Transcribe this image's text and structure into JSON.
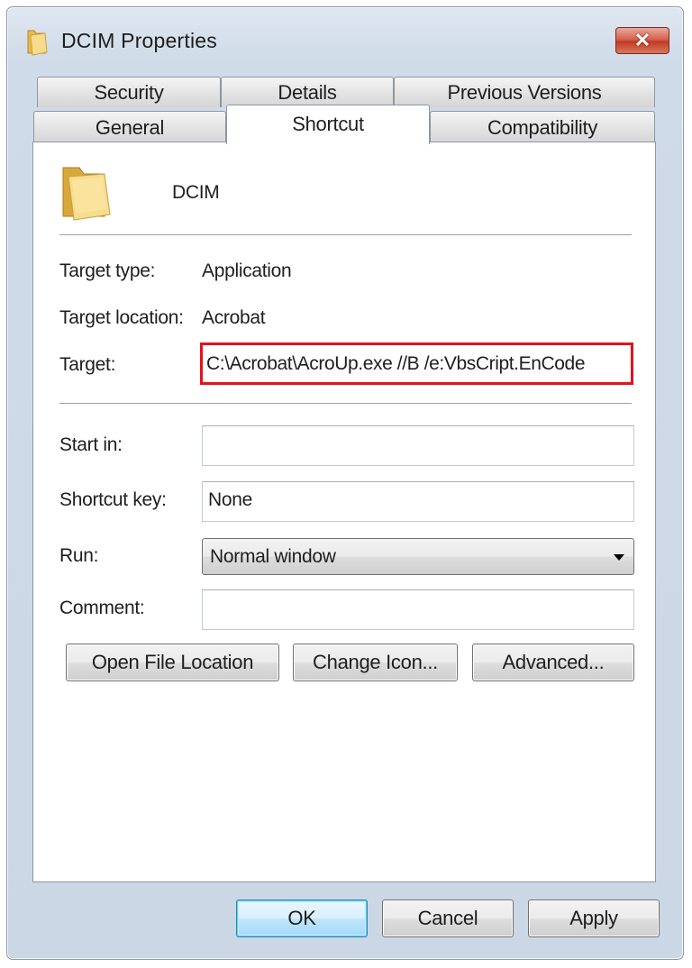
{
  "window": {
    "title": "DCIM Properties",
    "close_glyph": "✕"
  },
  "tabs_row1": [
    "Security",
    "Details",
    "Previous Versions"
  ],
  "tabs_row2": [
    "General",
    "Shortcut",
    "Compatibility"
  ],
  "active_tab": "Shortcut",
  "shortcut": {
    "name": "DCIM",
    "target_type_label": "Target type:",
    "target_type_value": "Application",
    "target_location_label": "Target location:",
    "target_location_value": "Acrobat",
    "target_label": "Target:",
    "target_value": "C:\\Acrobat\\AcroUp.exe //B /e:VbsCript.EnCode",
    "start_in_label": "Start in:",
    "start_in_value": "",
    "shortcut_key_label": "Shortcut key:",
    "shortcut_key_value": "None",
    "run_label": "Run:",
    "run_value": "Normal window",
    "comment_label": "Comment:",
    "comment_value": ""
  },
  "buttons": {
    "open_file_location": "Open File Location",
    "change_icon": "Change Icon...",
    "advanced": "Advanced...",
    "ok": "OK",
    "cancel": "Cancel",
    "apply": "Apply"
  },
  "icons": {
    "title": "folder-icon",
    "shortcut": "folder-icon"
  },
  "colors": {
    "highlight_border": "#e3111c",
    "close_button": "#c23b22",
    "folder": "#f3d27a"
  }
}
